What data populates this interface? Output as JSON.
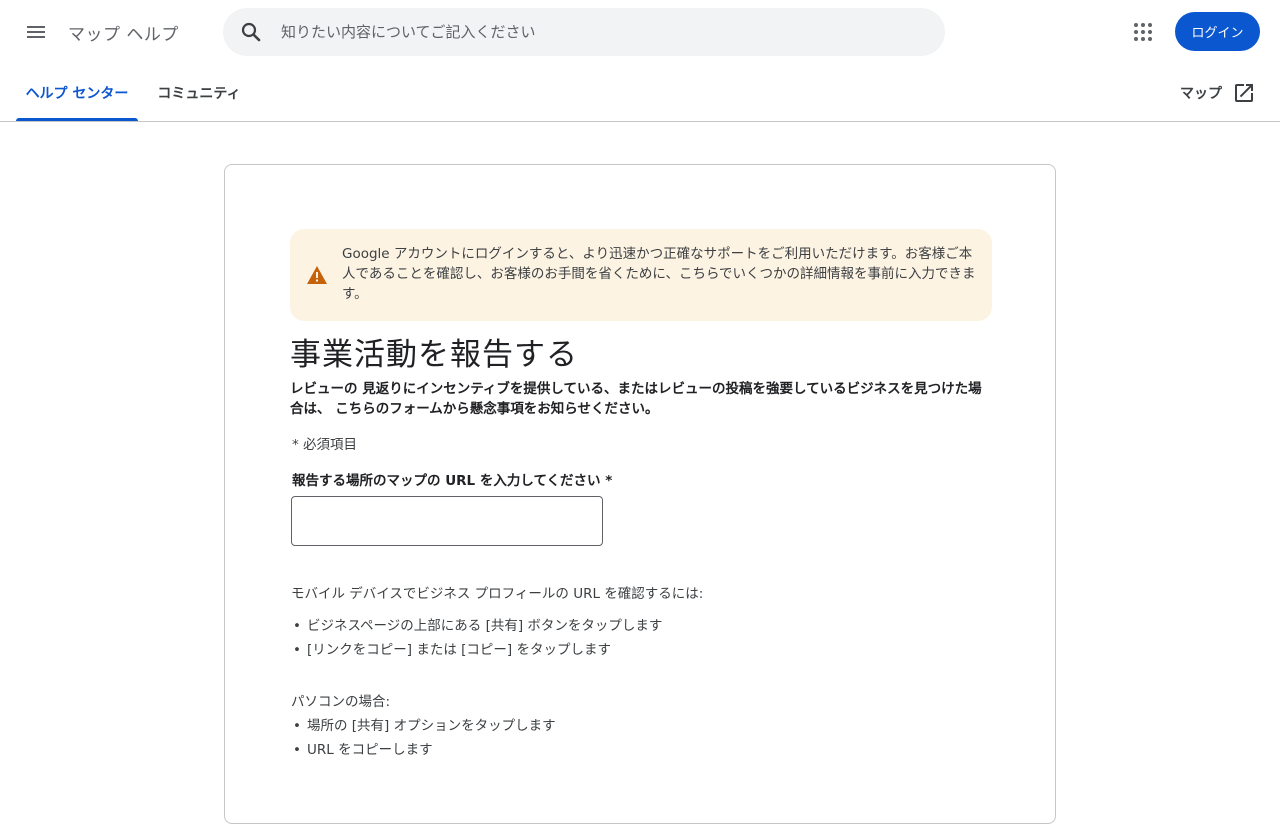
{
  "header": {
    "title": "マップ ヘルプ",
    "search_placeholder": "知りたい内容についてご記入ください",
    "login_label": "ログイン"
  },
  "tabs": {
    "help_center": "ヘルプ センター",
    "community": "コミュニティ",
    "maps_link": "マップ"
  },
  "warning": {
    "text": "Google アカウントにログインすると、より迅速かつ正確なサポートをご利用いただけます。お客様ご本人であることを確認し、お客様のお手間を省くために、こちらでいくつかの詳細情報を事前に入力できます。"
  },
  "form": {
    "title": "事業活動を報告する",
    "description": "レビューの 見返りにインセンティブを提供している、またはレビューの投稿を強要しているビジネスを見つけた場合は、 こちらのフォームから懸念事項をお知らせください。",
    "required_note": "* 必須項目",
    "url_label": "報告する場所のマップの URL を入力してください *",
    "url_value": ""
  },
  "help": {
    "mobile_heading": "モバイル デバイスでビジネス プロフィールの URL を確認するには:",
    "mobile_steps": [
      "ビジネスページの上部にある [共有] ボタンをタップします",
      "[リンクをコピー] または [コピー] をタップします"
    ],
    "pc_heading": "パソコンの場合:",
    "pc_steps": [
      "場所の [共有] オプションをタップします",
      "URL をコピーします"
    ]
  },
  "colors": {
    "accent": "#0b57d0",
    "warning_bg": "#fdf3e3",
    "warning_icon": "#c5630c"
  }
}
